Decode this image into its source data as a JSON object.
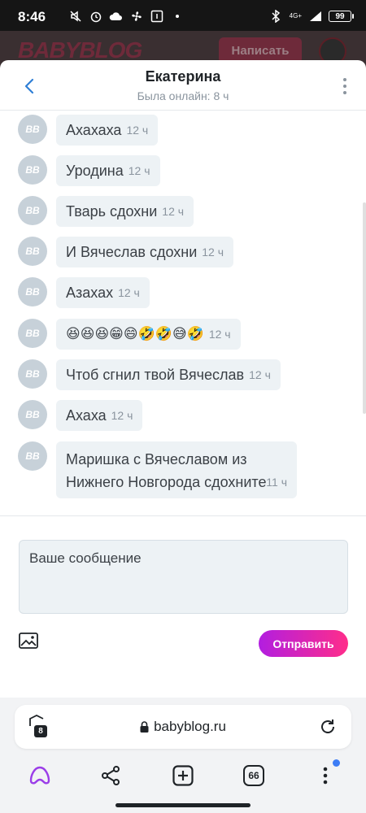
{
  "status_bar": {
    "time": "8:46",
    "network": "4G+",
    "battery": "99"
  },
  "site": {
    "logo": "BABYBLOG",
    "write_button": "Написать"
  },
  "dialog": {
    "contact_name": "Екатерина",
    "contact_status": "Была онлайн: 8 ч",
    "avatar_text": "BB",
    "messages": [
      {
        "text": "Ахахаха",
        "time": "12 ч"
      },
      {
        "text": "Уродина",
        "time": "12 ч"
      },
      {
        "text": "Тварь сдохни",
        "time": "12 ч"
      },
      {
        "text": "И Вячеслав сдохни",
        "time": "12 ч"
      },
      {
        "text": "Азахах",
        "time": "12 ч"
      },
      {
        "text": "😆😆😆😁😄🤣🤣😅🤣",
        "time": "12 ч"
      },
      {
        "text": "Чтоб сгнил твой Вячеслав",
        "time": "12 ч"
      },
      {
        "text": "Ахаха",
        "time": "12 ч"
      },
      {
        "text": "Маришка с Вячеславом из Нижнего Новгорода сдохните",
        "time": "11 ч"
      }
    ],
    "compose_placeholder": "Ваше сообщение",
    "send_button": "Отправить"
  },
  "browser": {
    "tabs_badge": "8",
    "url": "babyblog.ru",
    "tab_count": "66"
  }
}
